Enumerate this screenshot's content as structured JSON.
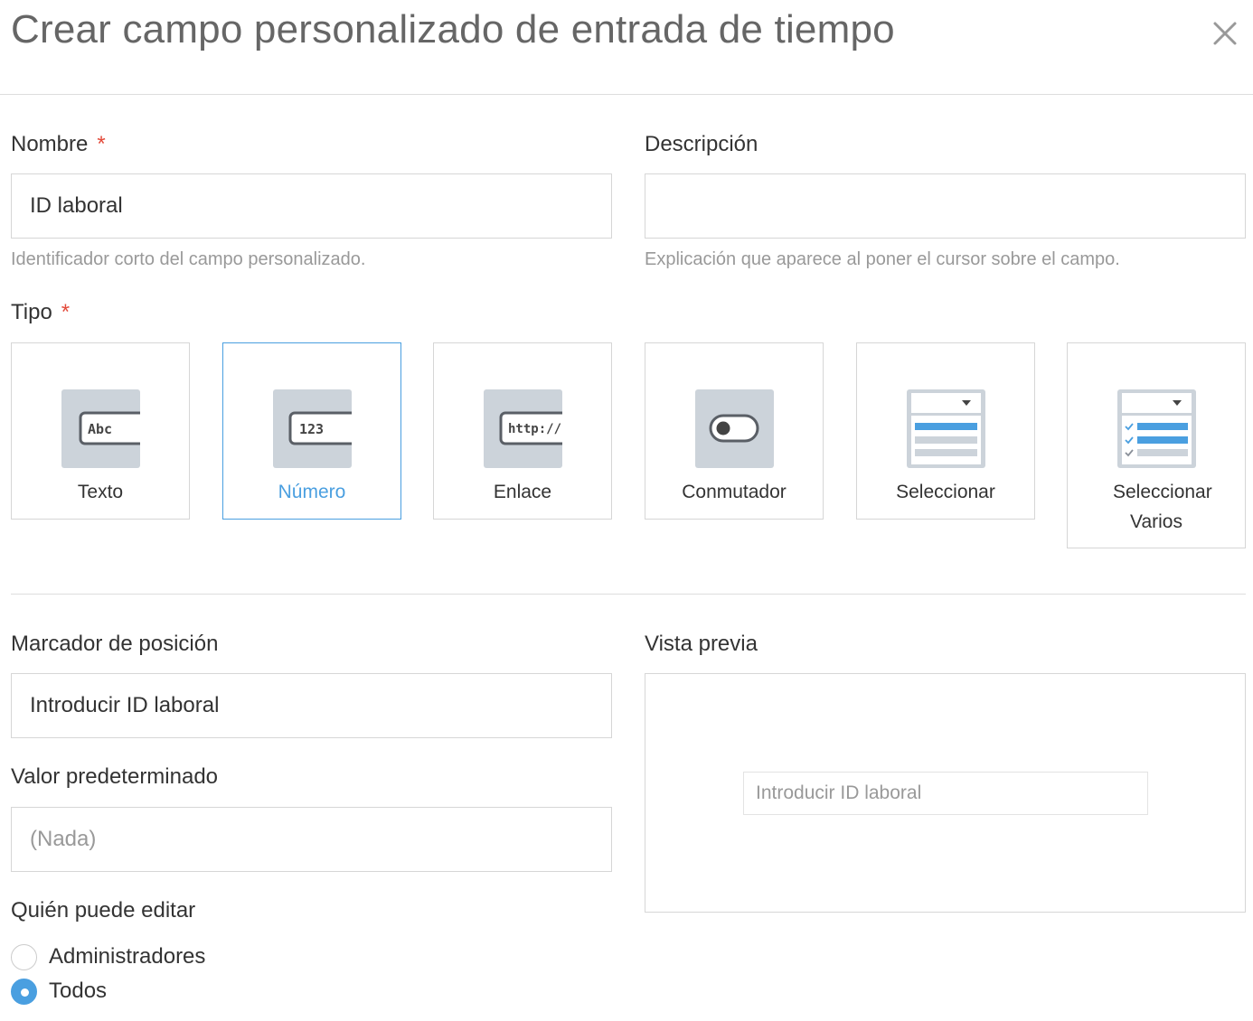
{
  "dialog": {
    "title": "Crear campo personalizado de entrada de tiempo",
    "close_icon": "close-icon"
  },
  "name_field": {
    "label": "Nombre",
    "required_mark": "*",
    "value": "ID laboral",
    "help": "Identificador corto del campo personalizado."
  },
  "description_field": {
    "label": "Descripción",
    "value": "",
    "help": "Explicación que aparece al poner el cursor sobre el campo."
  },
  "type_field": {
    "label": "Tipo",
    "required_mark": "*",
    "selected": "Número",
    "options": [
      {
        "label": "Texto",
        "icon": "text-field-icon",
        "icon_text": "Abc"
      },
      {
        "label": "Número",
        "icon": "number-field-icon",
        "icon_text": "123"
      },
      {
        "label": "Enlace",
        "icon": "link-field-icon",
        "icon_text": "http://"
      },
      {
        "label": "Conmutador",
        "icon": "toggle-icon"
      },
      {
        "label": "Seleccionar",
        "icon": "select-dropdown-icon"
      },
      {
        "label": "Seleccionar Varios",
        "icon": "multi-select-icon"
      }
    ]
  },
  "placeholder_field": {
    "label": "Marcador de posición",
    "value": "Introducir ID laboral"
  },
  "default_value_field": {
    "label": "Valor predeterminado",
    "placeholder": "(Nada)"
  },
  "preview": {
    "label": "Vista previa",
    "input_placeholder": "Introducir ID laboral"
  },
  "who_can_edit": {
    "label": "Quién puede editar",
    "options": [
      {
        "label": "Administradores",
        "checked": false
      },
      {
        "label": "Todos",
        "checked": true
      }
    ]
  },
  "colors": {
    "accent": "#4a9fe0",
    "required": "#e34a3a",
    "icon_bg": "#ccd3da",
    "muted_text": "#999999"
  }
}
